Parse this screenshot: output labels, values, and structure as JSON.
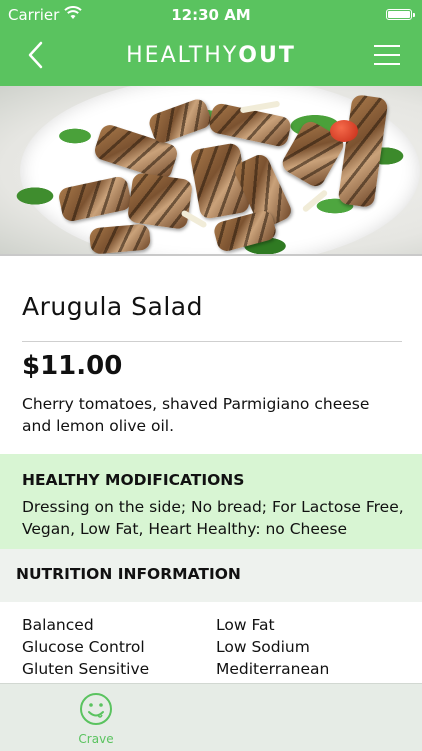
{
  "status_bar": {
    "carrier": "Carrier",
    "time": "12:30 AM"
  },
  "nav": {
    "brand_light": "HEALTHY",
    "brand_bold": "OUT"
  },
  "dish": {
    "name": "Arugula Salad",
    "price": "$11.00",
    "description": "Cherry tomatoes, shaved Parmigiano cheese and lemon olive oil."
  },
  "modifications": {
    "heading": "HEALTHY MODIFICATIONS",
    "text": "Dressing on the side; No bread; For Lactose Free, Vegan, Low Fat, Heart Healthy: no Cheese"
  },
  "nutrition": {
    "heading": "NUTRITION INFORMATION",
    "left": [
      "Balanced",
      "Glucose Control",
      "Gluten Sensitive"
    ],
    "right": [
      "Low Fat",
      "Low Sodium",
      "Mediterranean"
    ]
  },
  "tabbar": {
    "crave_label": "Crave"
  },
  "colors": {
    "brand_green": "#5ac35f",
    "mods_bg": "#d8f5d3",
    "section_bg": "#eef2ee"
  },
  "icons": [
    "wifi-icon",
    "battery-icon",
    "back-chevron-icon",
    "menu-icon",
    "smiley-icon"
  ]
}
